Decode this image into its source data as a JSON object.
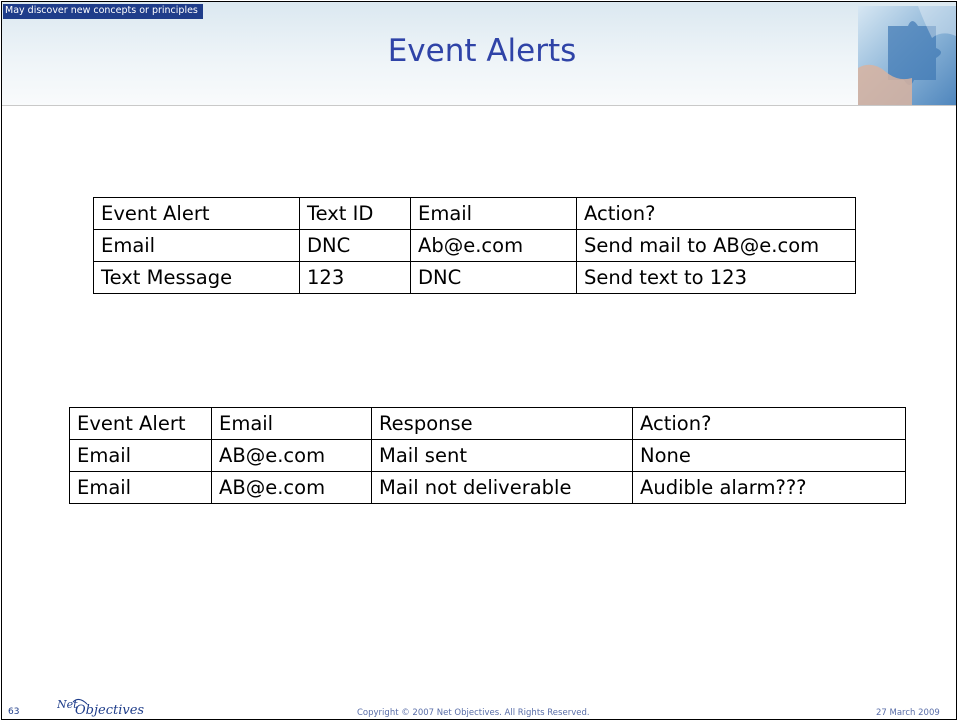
{
  "slide": {
    "tagline": "May discover new concepts or principles",
    "title": "Event Alerts",
    "page_number": "63",
    "logo_text": "Net Objectives",
    "copyright": "Copyright © 2007 Net Objectives. All Rights Reserved.",
    "date": "27 March 2009"
  },
  "table1": {
    "headers": [
      "Event Alert",
      "Text ID",
      "Email",
      "Action?"
    ],
    "rows": [
      [
        "Email",
        "DNC",
        "Ab@e.com",
        "Send mail to AB@e.com"
      ],
      [
        "Text Message",
        "123",
        "DNC",
        "Send text to 123"
      ]
    ]
  },
  "table2": {
    "headers": [
      "Event Alert",
      "Email",
      "Response",
      "Action?"
    ],
    "rows": [
      [
        "Email",
        "AB@e.com",
        "Mail sent",
        "None"
      ],
      [
        "Email",
        "AB@e.com",
        "Mail not deliverable",
        "Audible alarm???"
      ]
    ]
  }
}
